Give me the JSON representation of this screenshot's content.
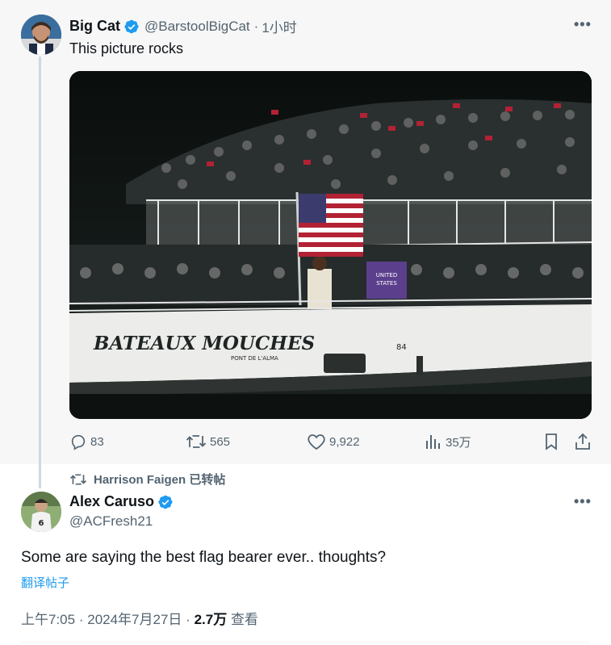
{
  "quoted_tweet": {
    "author_name": "Big Cat",
    "handle": "@BarstoolBigCat",
    "separator": "·",
    "time_ago": "1小时",
    "text": "This picture rocks",
    "media": {
      "boat_name": "BATEAUX MOUCHES",
      "boat_subtext": "PONT DE L'ALMA",
      "hull_number": "84",
      "banner_text_line1": "UNITED",
      "banner_text_line2": "STATES"
    },
    "actions": {
      "replies": "83",
      "retweets": "565",
      "likes": "9,922",
      "views": "35万"
    }
  },
  "retweet_header": {
    "text": "Harrison Faigen 已转帖"
  },
  "main_tweet": {
    "author_name": "Alex Caruso",
    "handle": "@ACFresh21",
    "text": "Some are saying the best flag bearer ever.. thoughts?",
    "translate_label": "翻译帖子",
    "time": "上午7:05",
    "separator": "·",
    "date": "2024年7月27日",
    "views_count": "2.7万",
    "views_label": "查看"
  },
  "colors": {
    "accent": "#1d9bf0",
    "secondary_text": "#536471"
  }
}
